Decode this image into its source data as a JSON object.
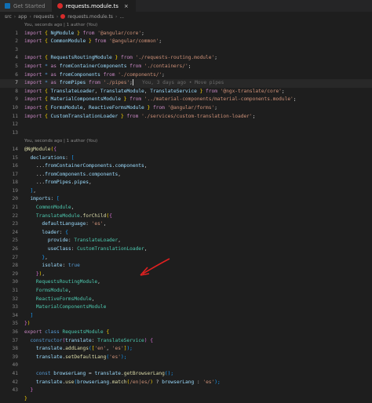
{
  "tabs": [
    {
      "label": "Get Started",
      "icon": "vscode-icon",
      "active": false
    },
    {
      "label": "requests.module.ts",
      "icon": "angular-icon",
      "active": true,
      "close": "×"
    }
  ],
  "breadcrumb": [
    "src",
    "app",
    "requests",
    "requests.module.ts",
    "..."
  ],
  "codelens": {
    "top": "You, seconds ago | 1 author (You)",
    "mid": "You, seconds ago | 1 author (You)"
  },
  "blame_line7": "You, 3 days ago • Move pipes",
  "line_numbers": [
    "1",
    "2",
    "3",
    "4",
    "5",
    "6",
    "7",
    "8",
    "9",
    "10",
    "11",
    "12",
    "13",
    "14",
    "15",
    "16",
    "17",
    "18",
    "19",
    "20",
    "21",
    "22",
    "23",
    "24",
    "25",
    "26",
    "27",
    "28",
    "29",
    "30",
    "31",
    "32",
    "33",
    "34",
    "35",
    "36",
    "37",
    "38",
    "39",
    "40",
    "41",
    "42",
    "43"
  ],
  "code": {
    "l1": [
      "import",
      " { ",
      "NgModule",
      " } ",
      "from",
      " ",
      "'@angular/core'",
      ";"
    ],
    "l2": [
      "import",
      " { ",
      "CommonModule",
      " } ",
      "from",
      " ",
      "'@angular/common'",
      ";"
    ],
    "l4": [
      "import",
      " { ",
      "RequestsRoutingModule",
      " } ",
      "from",
      " ",
      "'./requests-routing.module'",
      ";"
    ],
    "l5": [
      "import",
      " * ",
      "as",
      " ",
      "fromContainerComponents",
      " ",
      "from",
      " ",
      "'./containers/'",
      ";"
    ],
    "l6": [
      "import",
      " * ",
      "as",
      " ",
      "fromComponents",
      " ",
      "from",
      " ",
      "'./components/'",
      ";"
    ],
    "l7": [
      "import",
      " * ",
      "as",
      " ",
      "fromPipes",
      " ",
      "from",
      " ",
      "'./pipes'",
      ";"
    ],
    "l8": [
      "import",
      " { ",
      "TranslateLoader",
      ", ",
      "TranslateModule",
      ", ",
      "TranslateService",
      " } ",
      "from",
      " ",
      "'@ngx-translate/core'",
      ";"
    ],
    "l9": [
      "import",
      " { ",
      "MaterialComponentsModule",
      " } ",
      "from",
      " ",
      "'../material-components/material-components.module'",
      ";"
    ],
    "l10": [
      "import",
      " { ",
      "FormsModule",
      ", ",
      "ReactiveFormsModule",
      " } ",
      "from",
      " ",
      "'@angular/forms'",
      ";"
    ],
    "l11": [
      "import",
      " { ",
      "CustomTranslationLoader",
      " } ",
      "from",
      " ",
      "'./services/custom-translation-loader'",
      ";"
    ],
    "l14": [
      "@",
      "NgModule",
      "(",
      "{"
    ],
    "l15": [
      "  ",
      "declarations",
      ": ",
      "["
    ],
    "l16": [
      "    ...",
      "fromContainerComponents",
      ".",
      "components",
      ","
    ],
    "l17": [
      "    ...",
      "fromComponents",
      ".",
      "components",
      ","
    ],
    "l18": [
      "    ...",
      "fromPipes",
      ".",
      "pipes",
      ","
    ],
    "l19": [
      "  ",
      "]",
      ","
    ],
    "l20": [
      "  ",
      "imports",
      ": ",
      "["
    ],
    "l21": [
      "    ",
      "CommonModule",
      ","
    ],
    "l22": [
      "    ",
      "TranslateModule",
      ".",
      "forChild",
      "(",
      "{"
    ],
    "l23": [
      "      ",
      "defaultLanguage",
      ": ",
      "'es'",
      ","
    ],
    "l24": [
      "      ",
      "loader",
      ": ",
      "{"
    ],
    "l25": [
      "        ",
      "provide",
      ": ",
      "TranslateLoader",
      ","
    ],
    "l26": [
      "        ",
      "useClass",
      ": ",
      "CustomTranslationLoader",
      ","
    ],
    "l27": [
      "      ",
      "}",
      ","
    ],
    "l28": [
      "      ",
      "isolate",
      ": ",
      "true"
    ],
    "l29": [
      "    ",
      "}",
      ")",
      ","
    ],
    "l30": [
      "    ",
      "RequestsRoutingModule",
      ","
    ],
    "l31": [
      "    ",
      "FormsModule",
      ","
    ],
    "l32": [
      "    ",
      "ReactiveFormsModule",
      ","
    ],
    "l33": [
      "    ",
      "MaterialComponentsModule"
    ],
    "l34": [
      "  ",
      "]"
    ],
    "l35": [
      "}",
      ")"
    ],
    "l36": [
      "export",
      " ",
      "class",
      " ",
      "RequestsModule",
      " ",
      "{"
    ],
    "l37": [
      "  ",
      "constructor",
      "(",
      "translate",
      ": ",
      "TranslateService",
      ") ",
      "{"
    ],
    "l38": [
      "    ",
      "translate",
      ".",
      "addLangs",
      "(",
      "[",
      "'en'",
      ", ",
      "'es'",
      "]",
      ");"
    ],
    "l39": [
      "    ",
      "translate",
      ".",
      "setDefaultLang",
      "(",
      "'es'",
      ");"
    ],
    "l41": [
      "    ",
      "const",
      " ",
      "browserLang",
      " = ",
      "translate",
      ".",
      "getBrowserLang",
      "();"
    ],
    "l42": [
      "    ",
      "translate",
      ".",
      "use",
      "(",
      "browserLang",
      ".",
      "match",
      "(",
      "/en|es/",
      ") ",
      "?",
      " ",
      "browserLang",
      " : ",
      "'es'",
      ");"
    ],
    "l43": [
      "  ",
      "}"
    ],
    "l44": [
      "}"
    ]
  },
  "colors": {
    "background": "#1e1e1e",
    "annotation_arrow": "#e02020"
  }
}
